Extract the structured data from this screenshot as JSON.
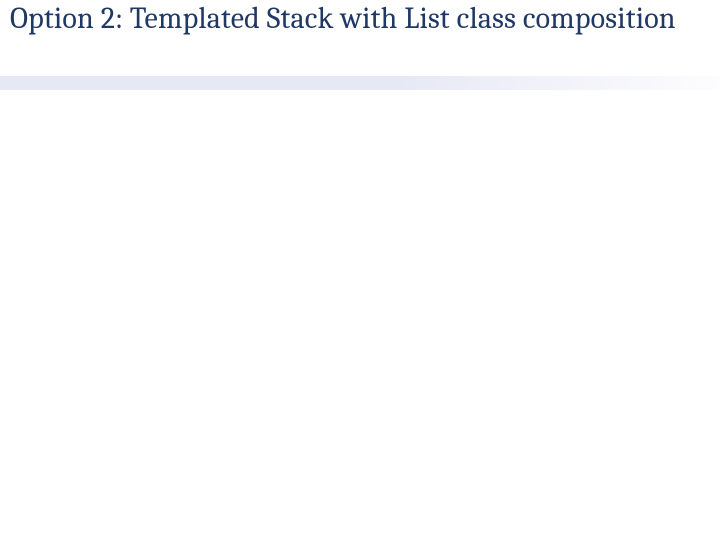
{
  "slide": {
    "title": "Option 2: Templated Stack with List class composition"
  },
  "colors": {
    "title": "#1f3864",
    "separator_from": "#e6e8f5",
    "separator_to": "#fdfdfe"
  }
}
